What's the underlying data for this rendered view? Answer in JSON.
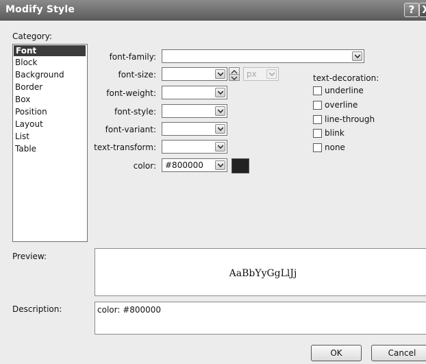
{
  "dialog": {
    "title": "Modify Style",
    "help_label": "?",
    "close_label": "X"
  },
  "category": {
    "label": "Category:",
    "items": [
      "Font",
      "Block",
      "Background",
      "Border",
      "Box",
      "Position",
      "Layout",
      "List",
      "Table"
    ],
    "selected": "Font"
  },
  "font": {
    "family": {
      "label": "font-family:",
      "value": ""
    },
    "size": {
      "label": "font-size:",
      "value": "",
      "unit": "px"
    },
    "weight": {
      "label": "font-weight:",
      "value": ""
    },
    "style": {
      "label": "font-style:",
      "value": ""
    },
    "variant": {
      "label": "font-variant:",
      "value": ""
    },
    "transform": {
      "label": "text-transform:",
      "value": ""
    },
    "color": {
      "label": "color:",
      "value": "#800000",
      "swatch": "#222222"
    }
  },
  "text_decoration": {
    "label": "text-decoration:",
    "options": [
      "underline",
      "overline",
      "line-through",
      "blink",
      "none"
    ]
  },
  "preview": {
    "label": "Preview:",
    "text": "AaBbYyGgLlJj"
  },
  "description": {
    "label": "Description:",
    "text": "color: #800000"
  },
  "buttons": {
    "ok": "OK",
    "cancel": "Cancel"
  }
}
